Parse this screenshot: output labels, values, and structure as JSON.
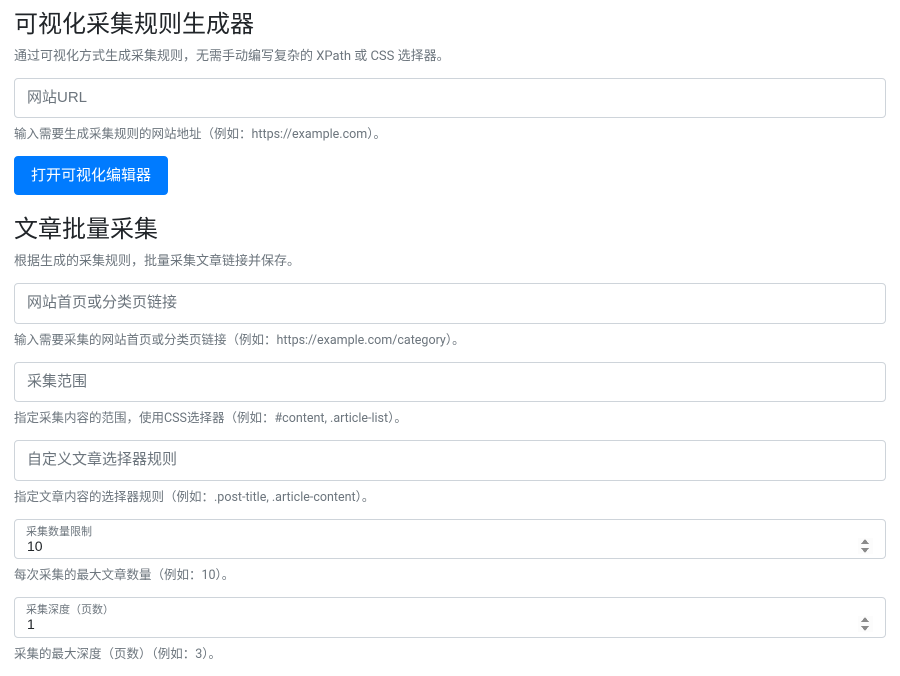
{
  "section1": {
    "title": "可视化采集规则生成器",
    "desc": "通过可视化方式生成采集规则，无需手动编写复杂的 XPath 或 CSS 选择器。",
    "url_placeholder": "网站URL",
    "url_help": "输入需要生成采集规则的网站地址（例如：https://example.com）。",
    "open_button": "打开可视化编辑器"
  },
  "section2": {
    "title": "文章批量采集",
    "desc": "根据生成的采集规则，批量采集文章链接并保存。",
    "homepage_placeholder": "网站首页或分类页链接",
    "homepage_help": "输入需要采集的网站首页或分类页链接（例如：https://example.com/category）。",
    "scope_placeholder": "采集范围",
    "scope_help": "指定采集内容的范围，使用CSS选择器（例如：#content, .article-list）。",
    "selector_placeholder": "自定义文章选择器规则",
    "selector_help": "指定文章内容的选择器规则（例如：.post-title, .article-content）。",
    "limit_label": "采集数量限制",
    "limit_value": "10",
    "limit_help": "每次采集的最大文章数量（例如：10）。",
    "depth_label": "采集深度（页数）",
    "depth_value": "1",
    "depth_help": "采集的最大深度（页数）（例如：3）。"
  }
}
